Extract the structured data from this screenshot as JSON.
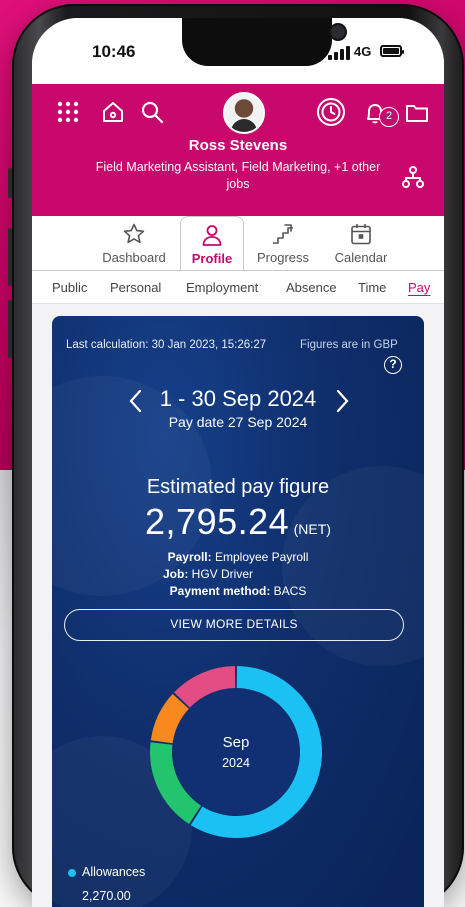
{
  "status_bar": {
    "time": "10:46",
    "network": "4G"
  },
  "header": {
    "user_name": "Ross Stevens",
    "user_role": "Field Marketing Assistant, Field Marketing, +1 other jobs",
    "notification_count": "2",
    "icons": [
      "apps-grid-icon",
      "home-icon",
      "search-icon",
      "clock-icon",
      "bell-icon",
      "folder-icon",
      "org-chart-icon"
    ],
    "brand_color": "#c8086c"
  },
  "nav": {
    "items": [
      {
        "label": "Dashboard",
        "icon": "star-icon"
      },
      {
        "label": "Profile",
        "icon": "person-icon"
      },
      {
        "label": "Progress",
        "icon": "stairs-icon"
      },
      {
        "label": "Calendar",
        "icon": "calendar-icon"
      }
    ],
    "active": "Profile"
  },
  "tabs": {
    "items": [
      "Public",
      "Personal",
      "Employment",
      "Absence",
      "Time",
      "Pay"
    ],
    "active": "Pay"
  },
  "pay_card": {
    "last_calculation": "Last calculation: 30 Jan 2023, 15:26:27",
    "figures_in": "Figures are in GBP",
    "period": "1 - 30 Sep 2024",
    "pay_date": "Pay date 27 Sep 2024",
    "estimated_label": "Estimated pay figure",
    "amount": "2,795.24",
    "amount_suffix": "(NET)",
    "payroll_label": "Payroll:",
    "payroll_value": "Employee Payroll",
    "job_label": "Job:",
    "job_value": "HGV Driver",
    "payment_label": "Payment method:",
    "payment_value": "BACS",
    "details_button": "VIEW MORE DETAILS",
    "donut_center_month": "Sep",
    "donut_center_year": "2024",
    "legend_first_name": "Allowances",
    "legend_first_value": "2,270.00"
  },
  "chart_data": {
    "type": "pie",
    "style": "donut",
    "center_label": [
      "Sep",
      "2024"
    ],
    "slices": [
      {
        "name": "Allowances",
        "value": 2270.0,
        "color": "#1cc1f4"
      },
      {
        "value": 0.18,
        "share": true,
        "color": "#22c46d"
      },
      {
        "value": 0.1,
        "share": true,
        "color": "#f7891f"
      },
      {
        "value": 0.13,
        "share": true,
        "color": "#e24e83"
      }
    ],
    "shares": [
      0.59,
      0.18,
      0.1,
      0.13
    ],
    "legend_position": "bottom-left"
  }
}
